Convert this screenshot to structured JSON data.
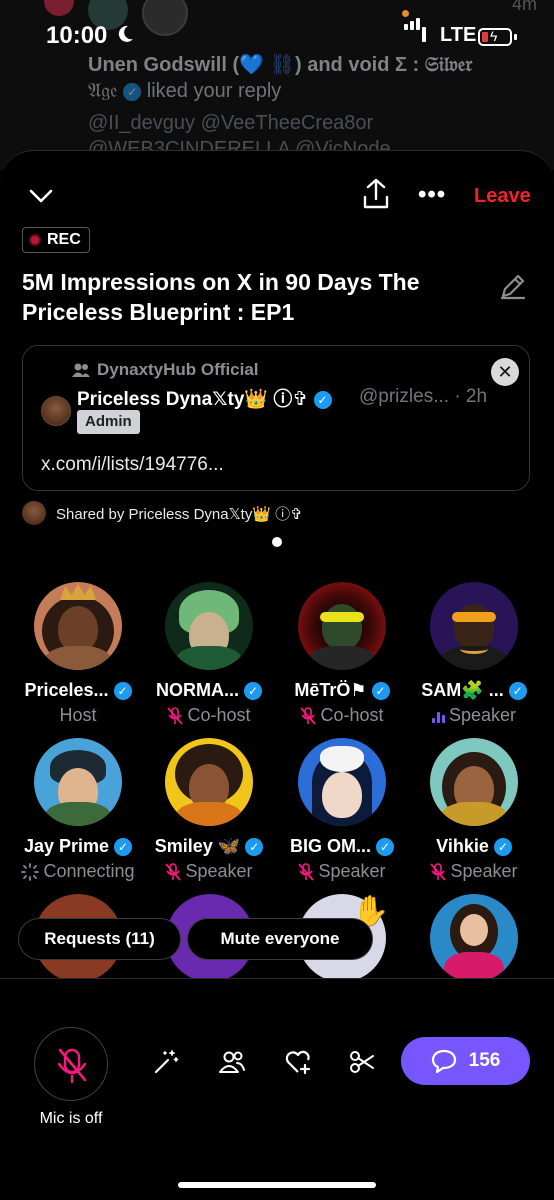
{
  "status_bar": {
    "time": "10:00",
    "network": "LTE"
  },
  "background_feed": {
    "time_ago": "4m",
    "notification_name1": "Unen Godswill (",
    "notification_mid": ") and void Σ : ",
    "notification_gothic1": "𝔖𝔦𝔩𝔳𝔢𝔯",
    "notification_gothic2": "𝔄𝔤𝔢",
    "notification_action": "liked your reply",
    "handles_line1": "@II_devguy @VeeTheeCrea8or",
    "handles_line2": "@WEB3CINDERELLA @VicNode"
  },
  "header": {
    "leave_label": "Leave",
    "rec_label": "REC"
  },
  "space": {
    "title": "5M Impressions on X in 90 Days The Priceless Blueprint : EP1"
  },
  "shared_post": {
    "community": "DynaxtyHub Official",
    "author_name": "Priceless Dyna𝕏ty👑",
    "author_symbols": "ⓘ✞",
    "author_handle": "@prizles...",
    "time": "· 2h",
    "badge": "Admin",
    "link_text": "x.com/i/lists/194776..."
  },
  "shared_by": {
    "text": "Shared by Priceless Dyna𝕏ty👑 ⓘ✞"
  },
  "participants": [
    {
      "name": "Pricelessss",
      "display": "Priceles...",
      "role": "Host",
      "status": "none"
    },
    {
      "name": "NORMA...",
      "display": "NORMA...",
      "role": "Co-host",
      "status": "muted"
    },
    {
      "name": "MēTrÖ🏴",
      "display": "MēTrÖ⚑",
      "role": "Co-host",
      "status": "muted"
    },
    {
      "name": "SAM🧩 ...",
      "display": "SAM🧩 ...",
      "role": "Speaker",
      "status": "speaking"
    },
    {
      "name": "Jay Prime",
      "display": "Jay Prime",
      "role": "Connecting",
      "status": "connecting"
    },
    {
      "name": "Smiley 🦋",
      "display": "Smiley 🦋",
      "role": "Speaker",
      "status": "muted"
    },
    {
      "name": "BIG OM...",
      "display": "BIG OM...",
      "role": "Speaker",
      "status": "muted"
    },
    {
      "name": "Vihkie",
      "display": "Vihkie",
      "role": "Speaker",
      "status": "muted"
    }
  ],
  "actions": {
    "requests_label": "Requests (11)",
    "mute_everyone_label": "Mute everyone",
    "mic_label": "Mic is off",
    "chat_count": "156"
  },
  "colors": {
    "accent": "#7856ff",
    "leave": "#f4212e",
    "verified": "#1d9bf0",
    "muted_icon": "#f91880"
  }
}
